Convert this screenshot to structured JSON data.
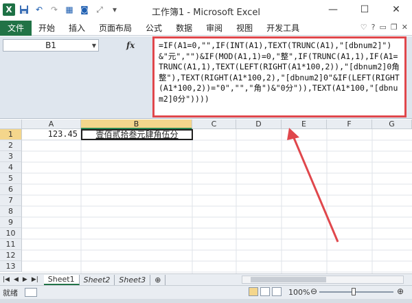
{
  "window": {
    "title": "工作簿1 - Microsoft Excel",
    "minimize": "—",
    "maximize": "☐",
    "close": "✕"
  },
  "ribbon": {
    "file_tab": "文件",
    "tabs": [
      "开始",
      "插入",
      "页面布局",
      "公式",
      "数据",
      "审阅",
      "视图",
      "开发工具"
    ]
  },
  "formula_bar": {
    "name_box": "B1",
    "fx_label": "fx",
    "formula": "=IF(A1=0,\"\",IF(INT(A1),TEXT(TRUNC(A1),\"[dbnum2]\")&\"元\",\"\")&IF(MOD(A1,1)=0,\"整\",IF(TRUNC(A1,1),IF(A1=TRUNC(A1,1),TEXT(LEFT(RIGHT(A1*100,2)),\"[dbnum2]0角整\"),TEXT(RIGHT(A1*100,2),\"[dbnum2]0\"&IF(LEFT(RIGHT(A1*100,2))=\"0\",\"\",\"角\")&\"0分\")),TEXT(A1*100,\"[dbnum2]0分\"))))"
  },
  "sheet": {
    "columns": [
      "A",
      "B",
      "C",
      "D",
      "E",
      "F",
      "G"
    ],
    "rows": [
      "1",
      "2",
      "3",
      "4",
      "5",
      "6",
      "7",
      "8",
      "9",
      "10",
      "11",
      "12",
      "13"
    ],
    "a1": "123.45",
    "b1": "壹佰贰拾叁元肆角伍分"
  },
  "sheet_tabs": [
    "Sheet1",
    "Sheet2",
    "Sheet3"
  ],
  "status": {
    "ready": "就绪",
    "zoom": "100%"
  },
  "colors": {
    "excel_green": "#217346",
    "highlight_red": "#e0474c"
  }
}
